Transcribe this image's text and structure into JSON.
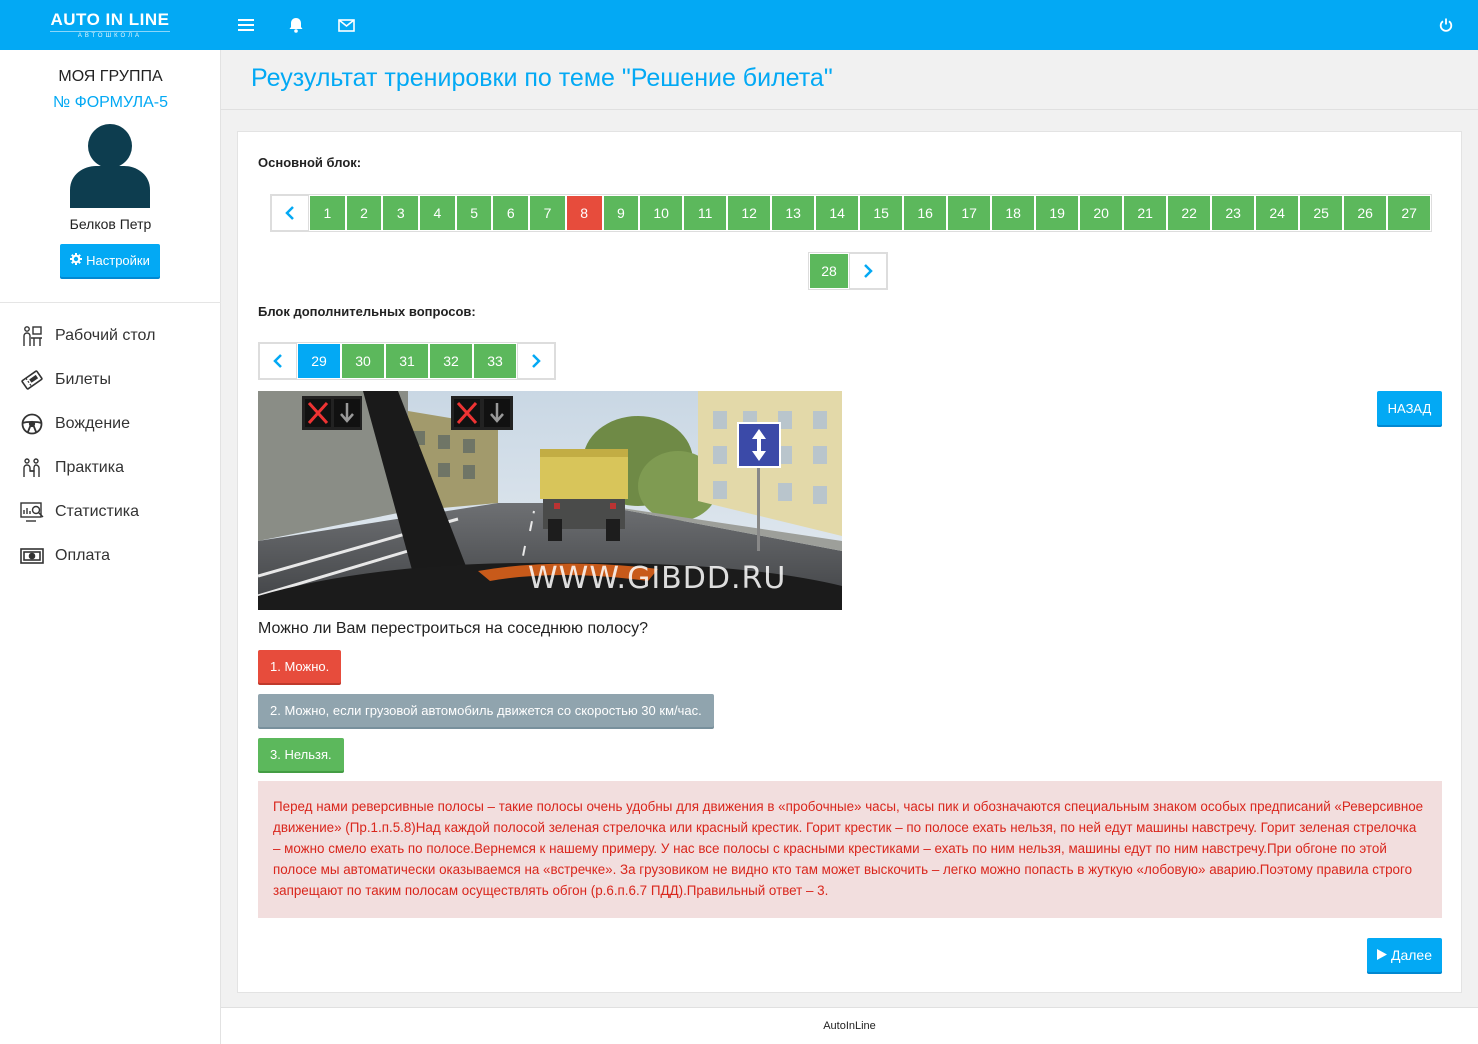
{
  "topbar": {
    "logo_main": "AUTO IN LINE",
    "logo_sub": "АВТОШКОЛА",
    "icons": [
      "menu-icon",
      "bell-icon",
      "envelope-icon",
      "power-icon"
    ]
  },
  "sidebar": {
    "group_label": "МОЯ ГРУППА",
    "group_name": "№ ФОРМУЛА-5",
    "user_name": "Белков Петр",
    "settings_label": "Настройки",
    "nav": [
      {
        "label": "Рабочий стол",
        "icon": "desk-icon"
      },
      {
        "label": "Билеты",
        "icon": "ticket-icon"
      },
      {
        "label": "Вождение",
        "icon": "steering-wheel-icon"
      },
      {
        "label": "Практика",
        "icon": "practice-icon"
      },
      {
        "label": "Статистика",
        "icon": "statistics-icon"
      },
      {
        "label": "Оплата",
        "icon": "payment-icon"
      }
    ]
  },
  "page": {
    "title": "Реузультат тренировки по теме \"Решение билета\""
  },
  "main_block": {
    "label": "Основной блок:",
    "pages_row1": [
      "1",
      "2",
      "3",
      "4",
      "5",
      "6",
      "7",
      "8",
      "9",
      "10",
      "11",
      "12",
      "13",
      "14",
      "15",
      "16",
      "17",
      "18",
      "19",
      "20",
      "21",
      "22",
      "23",
      "24",
      "25",
      "26",
      "27"
    ],
    "pages_row2": [
      "28"
    ],
    "wrong_page": "8"
  },
  "extra_block": {
    "label": "Блок дополнительных вопросов:",
    "pages": [
      "29",
      "30",
      "31",
      "32",
      "33"
    ],
    "current_page": "29"
  },
  "question": {
    "image_watermark": "WWW.GIBDD.RU",
    "back_label": "НАЗАД",
    "text": "Можно ли Вам перестроиться на соседнюю полосу?",
    "answers": [
      "1. Можно.",
      "2. Можно, если грузовой автомобиль движется со скоростью 30 км/час.",
      "3. Нельзя."
    ],
    "explanation": "Перед нами реверсивные полосы – такие полосы очень удобны для движения в «пробочные» часы, часы пик и обозначаются специальным знаком особых предписаний «Реверсивное движение» (Пр.1.п.5.8)Над каждой полосой зеленая стрелочка или красный крестик. Горит крестик – по полосе ехать нельзя, по ней едут машины навстречу. Горит зеленая стрелочка – можно смело ехать по полосе.Вернемся к нашему примеру. У нас все полосы с красными крестиками – ехать по ним нельзя, машины едут по ним навстречу.При обгоне по этой полосе мы автоматически оказываемся на «встречке». За грузовиком не видно кто там может выскочить – легко можно попасть в жуткую «лобовую» аварию.Поэтому правила строго запрещают по таким полосам осуществлять обгон (р.6.п.6.7 ПДД).Правильный ответ – 3.",
    "next_label": "Далее"
  },
  "footer": {
    "text": "AutoInLine"
  },
  "colors": {
    "accent": "#03a9f4",
    "correct": "#5cb85c",
    "wrong": "#e74c3c",
    "explain_bg": "#f2dede",
    "explain_text": "#d9261c"
  }
}
